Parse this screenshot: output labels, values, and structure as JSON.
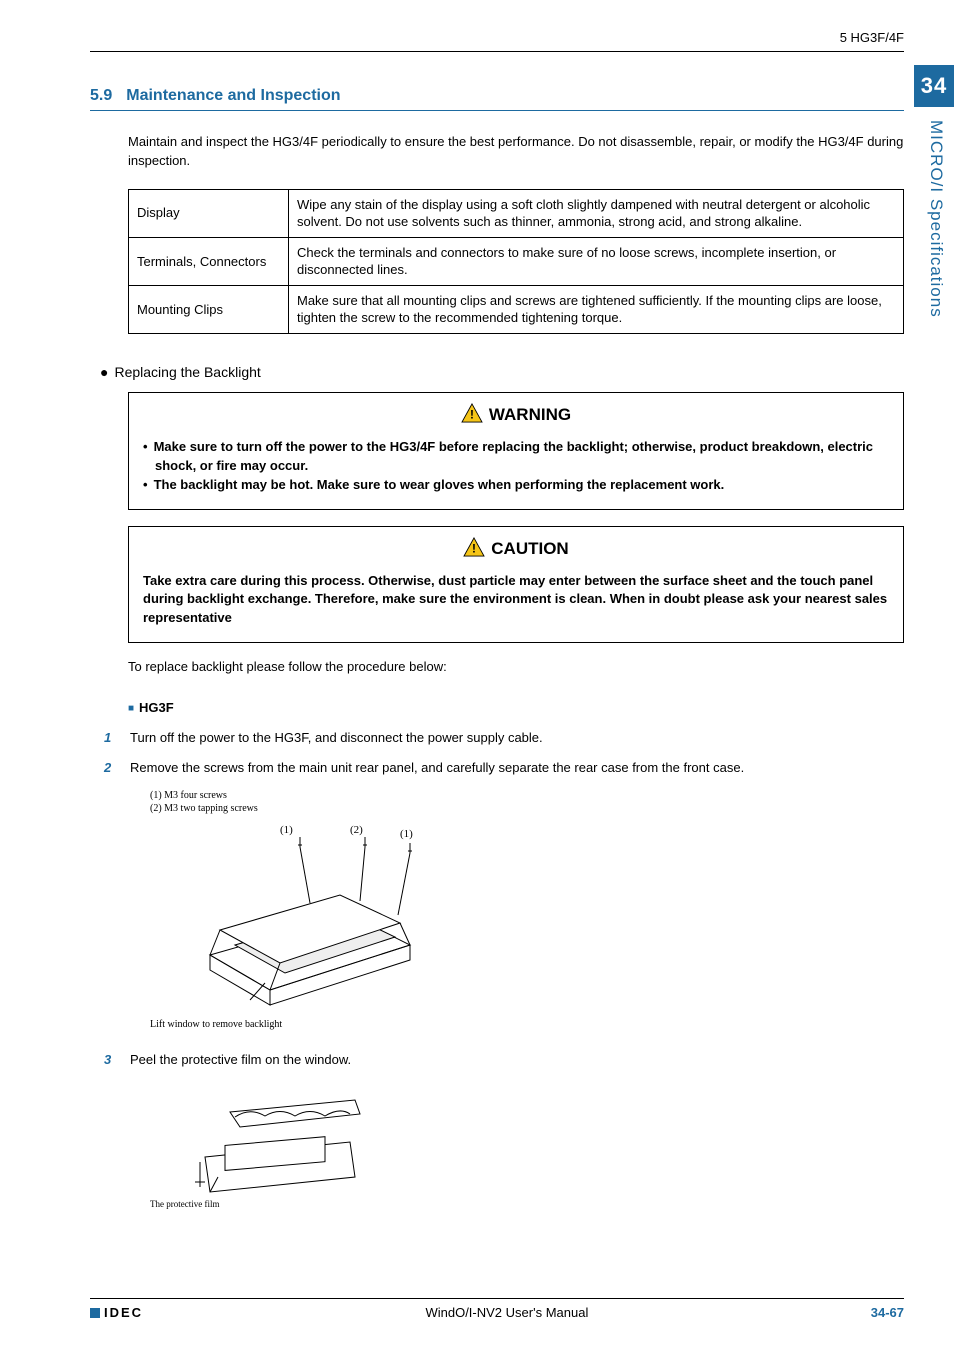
{
  "header": {
    "breadcrumb": "5 HG3F/4F"
  },
  "chapter": {
    "number": "34",
    "side_label": "MICRO/I Specifications"
  },
  "section": {
    "number": "5.9",
    "title": "Maintenance and Inspection"
  },
  "intro": "Maintain and inspect the HG3/4F periodically to ensure the best performance. Do not disassemble, repair, or modify the HG3/4F during inspection.",
  "table": {
    "rows": [
      {
        "label": "Display",
        "desc": "Wipe any stain of the display using a soft cloth slightly dampened with neutral detergent or alcoholic solvent. Do not use solvents such as thinner, ammonia, strong acid, and strong alkaline."
      },
      {
        "label": "Terminals, Connectors",
        "desc": "Check the terminals and connectors to make sure of no loose screws, incomplete insertion, or disconnected lines."
      },
      {
        "label": "Mounting Clips",
        "desc": "Make sure that all mounting clips and screws are tightened sufficiently. If the mounting clips are loose, tighten the screw to the recommended tightening torque."
      }
    ]
  },
  "backlight_heading": "Replacing the Backlight",
  "warning": {
    "label": "WARNING",
    "items": [
      "Make sure to turn off the power to the HG3/4F before replacing the backlight; otherwise, product breakdown, electric shock, or fire may occur.",
      "The backlight may be hot. Make sure to wear gloves when performing the replacement work."
    ]
  },
  "caution": {
    "label": "CAUTION",
    "body": "Take extra care during this process. Otherwise, dust particle may enter between the surface sheet and the touch panel during backlight exchange. Therefore, make sure the environment is clean. When in doubt please ask your nearest sales representative"
  },
  "replace_intro": "To replace backlight please follow the procedure below:",
  "model_heading": "HG3F",
  "steps": [
    {
      "n": "1",
      "text": "Turn off the power to the HG3F, and disconnect the power supply cable."
    },
    {
      "n": "2",
      "text": "Remove the screws from the main unit rear panel, and carefully separate the rear case from the front case."
    },
    {
      "n": "3",
      "text": "Peel the protective film on the window."
    }
  ],
  "fig1": {
    "cap1": "(1) M3 four screws",
    "cap2": "(2) M3 two tapping screws",
    "label1": "(1)",
    "label2": "(2)",
    "bottom": "Lift window to remove backlight"
  },
  "fig2": {
    "label": "The protective film"
  },
  "footer": {
    "logo": "IDEC",
    "center": "WindO/I-NV2 User's Manual",
    "page": "34-67"
  }
}
